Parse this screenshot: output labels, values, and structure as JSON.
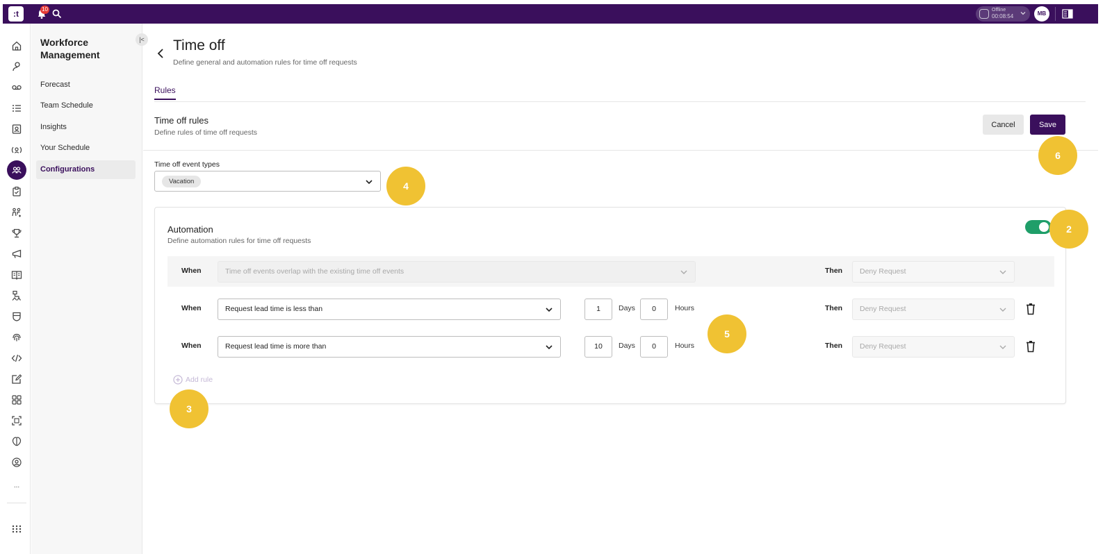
{
  "topbar": {
    "logo_text": ":t",
    "notification_count": "10",
    "status": {
      "label": "Offline",
      "timer": "00:08:54"
    },
    "user_initials": "MB"
  },
  "rail": {
    "icons": [
      "home-icon",
      "agent-icon",
      "voicemail-icon",
      "list-icon",
      "contact-card-icon",
      "live-monitor-icon",
      "workforce-icon",
      "clipboard-icon",
      "team-icon",
      "trophy-icon",
      "campaign-icon",
      "book-icon",
      "routing-icon",
      "shield-icon",
      "fingerprint-icon",
      "code-icon",
      "edit-icon",
      "grid-icon",
      "scan-icon",
      "ai-icon",
      "supervisor-icon"
    ],
    "active": "workforce-icon",
    "more_label": "...",
    "apps_icon": "apps-grid-icon"
  },
  "subnav": {
    "title": "Workforce Management",
    "items": [
      {
        "label": "Forecast",
        "active": false
      },
      {
        "label": "Team Schedule",
        "active": false
      },
      {
        "label": "Insights",
        "active": false
      },
      {
        "label": "Your Schedule",
        "active": false
      },
      {
        "label": "Configurations",
        "active": true
      }
    ]
  },
  "page": {
    "title": "Time off",
    "subtitle": "Define general and automation rules for time off requests",
    "tabs": [
      {
        "label": "Rules",
        "active": true
      }
    ]
  },
  "rules_section": {
    "title": "Time off rules",
    "subtitle": "Define rules of time off requests",
    "cancel_label": "Cancel",
    "save_label": "Save"
  },
  "event_types": {
    "label": "Time off event types",
    "selected_chip": "Vacation"
  },
  "automation": {
    "title": "Automation",
    "subtitle": "Define automation rules for time off requests",
    "enabled": true,
    "rules": [
      {
        "when_label": "When",
        "condition": "Time off events overlap with the existing time off events",
        "then_label": "Then",
        "action": "Deny Request",
        "disabled": true
      },
      {
        "when_label": "When",
        "condition": "Request lead time is less than",
        "days": "1",
        "days_label": "Days",
        "hours": "0",
        "hours_label": "Hours",
        "then_label": "Then",
        "action": "Deny Request",
        "disabled": false
      },
      {
        "when_label": "When",
        "condition": "Request lead time is more than",
        "days": "10",
        "days_label": "Days",
        "hours": "0",
        "hours_label": "Hours",
        "then_label": "Then",
        "action": "Deny Request",
        "disabled": false
      }
    ],
    "add_rule_label": "Add rule"
  },
  "callouts": [
    "2",
    "3",
    "4",
    "5",
    "6"
  ],
  "colors": {
    "brand": "#3a0f5c",
    "toggle_on": "#1f9e69",
    "callout": "#f0c233"
  }
}
